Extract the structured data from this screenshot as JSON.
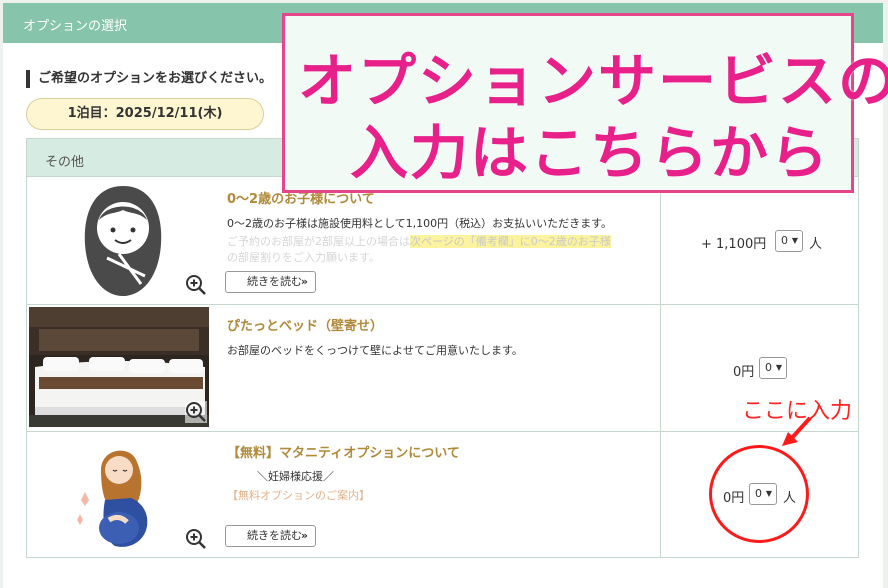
{
  "header": {
    "title": "オプションの選択"
  },
  "prompt": "ご希望のオプションをお選びください。",
  "date_label": "1泊目：2025/12/11(木)",
  "table": {
    "section_title": "その他",
    "rows": [
      {
        "title": "0～2歳のお子様について",
        "description": "0～2歳のお子様は施設使用料として1,100円（税込）お支払いいただきます。",
        "faded_prefix": "ご予約のお部屋が2部屋以上の場合は",
        "faded_highlight": "次ページの「備考欄」に0～2歳のお子様",
        "faded_rest": "の部屋割りをご入力願います。",
        "read_more": "続きを読む",
        "price": "+ 1,100円",
        "qty": "0",
        "unit": "人"
      },
      {
        "title": "ぴたっとベッド（壁寄せ）",
        "description": "お部屋のベッドをくっつけて壁によせてご用意いたします。",
        "price": "0円",
        "qty": "0"
      },
      {
        "title": "【無料】マタニティオプションについて",
        "subtitle": "＼妊婦様応援／",
        "link": "【無料オプションのご案内】",
        "read_more": "続きを読む",
        "price": "0円",
        "qty": "0",
        "unit": "人"
      }
    ]
  },
  "annotation": {
    "line1": "オプションサービスの",
    "line2": "入力はこちらから",
    "note": "ここに入力"
  },
  "colors": {
    "header_bg": "#86c4ab",
    "annotation_pink": "#e8208a",
    "annotation_red": "#ff1a1a",
    "row_title": "#b08a3a"
  }
}
